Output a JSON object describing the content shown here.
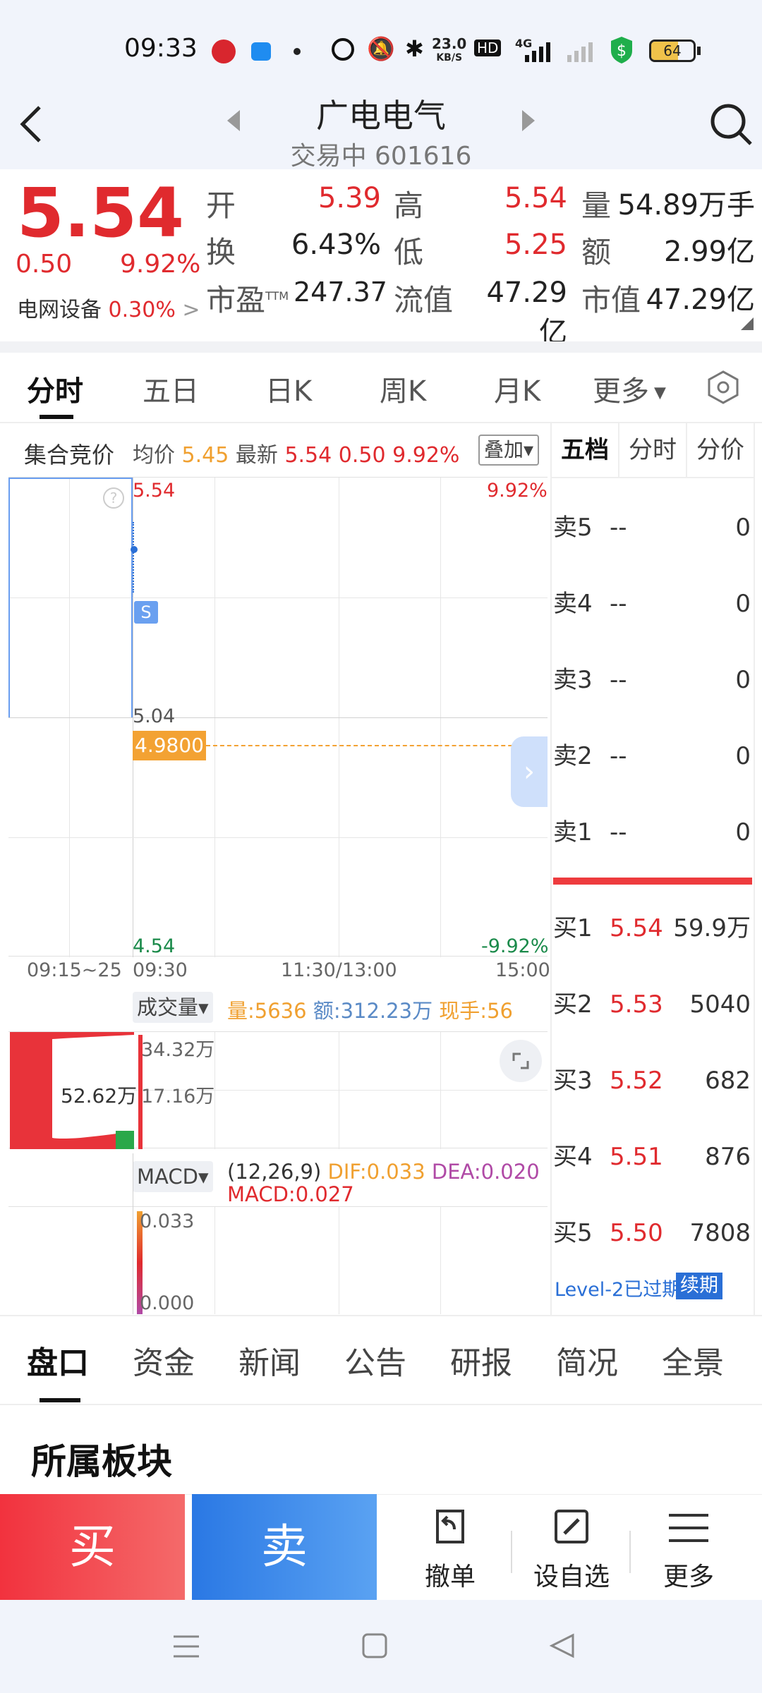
{
  "status": {
    "time": "09:33",
    "net_speed_top": "23.0",
    "net_speed_bottom": "KB/S",
    "hd": "HD",
    "net": "4G",
    "battery": "64"
  },
  "header": {
    "title": "广电电气",
    "subtitle": "交易中 601616"
  },
  "quote": {
    "price": "5.54",
    "change": "0.50",
    "change_pct": "9.92%",
    "sector": "电网设备",
    "sector_pct": "0.30%",
    "sector_arrow": ">",
    "open_label": "开",
    "open": "5.39",
    "high_label": "高",
    "high": "5.54",
    "vol_label": "量",
    "vol": "54.89万手",
    "turnover_label": "换",
    "turnover": "6.43%",
    "low_label": "低",
    "low": "5.25",
    "amount_label": "额",
    "amount": "2.99亿",
    "pe_label": "市盈",
    "pe_sup": "TTM",
    "pe": "247.37",
    "float_label": "流值",
    "float_cap": "47.29亿",
    "mcap_label": "市值",
    "mcap": "47.29亿"
  },
  "tabs": [
    "分时",
    "五日",
    "日K",
    "周K",
    "月K",
    "更多"
  ],
  "chart_header": {
    "auction": "集合竞价",
    "avg_label": "均价",
    "avg": "5.45",
    "latest_label": "最新",
    "latest": "5.54",
    "chg": "0.50",
    "chg_pct": "9.92%",
    "overlay": "叠加"
  },
  "chart": {
    "top_price": "5.54",
    "top_pct": "9.92%",
    "mid_price": "5.04",
    "bot_price": "4.54",
    "bot_pct": "-9.92%",
    "marker_price": "4.9800",
    "s_badge": "S",
    "x_labels": [
      "09:15~25",
      "09:30",
      "11:30/13:00",
      "15:00"
    ]
  },
  "volume": {
    "selector": "成交量",
    "vol_label": "量:",
    "vol": "5636",
    "amt_label": "额:",
    "amt": "312.23万",
    "hand_label": "现手:",
    "hand": "56",
    "auction_vol": "52.62万",
    "tick_top": "34.32万",
    "tick_mid": "17.16万"
  },
  "macd": {
    "selector": "MACD",
    "params": "(12,26,9)",
    "dif": "DIF:0.033",
    "dea": "DEA:0.020",
    "macd": "MACD:0.027",
    "tick_top": "0.033",
    "tick_bot": "0.000"
  },
  "orderbook": {
    "tabs": [
      "五档",
      "分时",
      "分价"
    ],
    "asks": [
      {
        "label": "卖5",
        "price": "--",
        "vol": "0"
      },
      {
        "label": "卖4",
        "price": "--",
        "vol": "0"
      },
      {
        "label": "卖3",
        "price": "--",
        "vol": "0"
      },
      {
        "label": "卖2",
        "price": "--",
        "vol": "0"
      },
      {
        "label": "卖1",
        "price": "--",
        "vol": "0"
      }
    ],
    "bids": [
      {
        "label": "买1",
        "price": "5.54",
        "vol": "59.9万"
      },
      {
        "label": "买2",
        "price": "5.53",
        "vol": "5040"
      },
      {
        "label": "买3",
        "price": "5.52",
        "vol": "682"
      },
      {
        "label": "买4",
        "price": "5.51",
        "vol": "876"
      },
      {
        "label": "买5",
        "price": "5.50",
        "vol": "7808"
      }
    ],
    "level2": "Level-2已过期",
    "renew": "续期"
  },
  "bottom_tabs": [
    "盘口",
    "资金",
    "新闻",
    "公告",
    "研报",
    "简况",
    "全景"
  ],
  "section_title": "所属板块",
  "actions": {
    "buy": "买",
    "sell": "卖",
    "cancel": "撤单",
    "watch": "设自选",
    "more": "更多"
  }
}
